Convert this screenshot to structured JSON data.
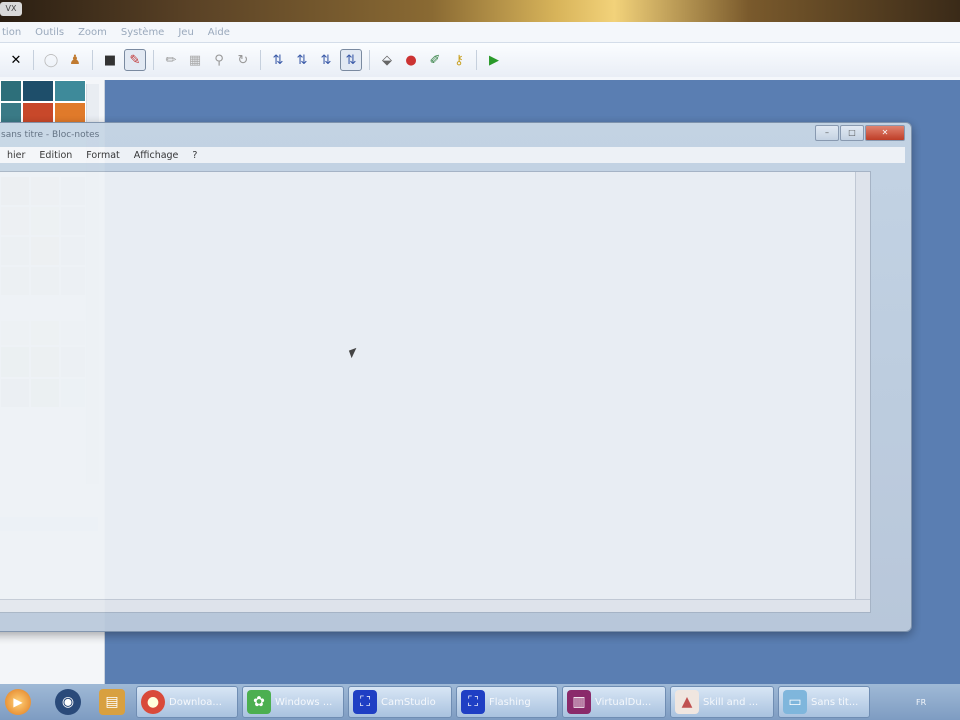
{
  "desktop": {
    "badge": "VX"
  },
  "editor": {
    "menu": [
      "tion",
      "Outils",
      "Zoom",
      "Système",
      "Jeu",
      "Aide"
    ],
    "toolbar_icons": [
      "close-icon",
      "disc-icon",
      "user-icon",
      "film-icon",
      "camera-icon",
      "pencil-icon",
      "grid-icon",
      "zoom-icon",
      "rotate-icon",
      "layer1-icon",
      "layer2-icon",
      "layer3-icon",
      "layer-all-icon",
      "paint-bucket-icon",
      "record-icon",
      "brush-icon",
      "key-icon",
      "play-icon"
    ]
  },
  "notepad": {
    "title": "sans titre - Bloc-notes",
    "menu": [
      "hier",
      "Edition",
      "Format",
      "Affichage",
      "?"
    ],
    "controls": {
      "minimize": "–",
      "maximize": "□",
      "close": "✕"
    }
  },
  "taskbar": {
    "items": [
      {
        "label": "Downloa...",
        "icon": "chrome-icon",
        "color": "#d94a3a"
      },
      {
        "label": "Windows ...",
        "icon": "windows-live-icon",
        "color": "#4caf50"
      },
      {
        "label": "CamStudio",
        "icon": "camstudio-icon",
        "color": "#1f3fc4"
      },
      {
        "label": "Flashing",
        "icon": "flashing-icon",
        "color": "#1f3fc4"
      },
      {
        "label": "VirtualDu...",
        "icon": "winrar-icon",
        "color": "#8a2a6a"
      },
      {
        "label": "Skill and ...",
        "icon": "skill-icon",
        "color": "#c05050"
      },
      {
        "label": "Sans tit...",
        "icon": "notepad-icon",
        "color": "#7fb6dc"
      }
    ],
    "tray": "FR"
  }
}
